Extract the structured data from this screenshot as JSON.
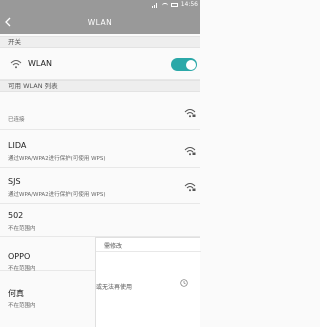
{
  "status_bar": {
    "time": "14:56",
    "icons": [
      "signal-icon",
      "wifi-status-icon",
      "battery-icon"
    ]
  },
  "header": {
    "title": "WLAN",
    "back_icon": "back-arrow-icon"
  },
  "switch_section": {
    "header": "开关",
    "wlan_label": "WLAN",
    "toggle_on": true
  },
  "available_section": {
    "header": "可用 WLAN 列表",
    "networks": [
      {
        "name": "",
        "status": "已连接",
        "secured": true,
        "in_range": true
      },
      {
        "name": "LIDA",
        "status": "通过WPA/WPA2进行保护(可使用 WPS)",
        "secured": true,
        "in_range": true
      },
      {
        "name": "SJS",
        "status": "通过WPA/WPA2进行保护(可使用 WPS)",
        "secured": true,
        "in_range": true
      },
      {
        "name": "502",
        "status": "不在范围内",
        "in_range": false
      },
      {
        "name": "OPPO",
        "status": "不在范围内",
        "in_range": false
      },
      {
        "name": "何真",
        "status": "不在范围内",
        "in_range": false
      }
    ]
  },
  "overlay": {
    "line1": "需修改",
    "line2": "或无法再使用"
  },
  "colors": {
    "accent": "#2ba8a8",
    "title_bar": "#999999"
  }
}
